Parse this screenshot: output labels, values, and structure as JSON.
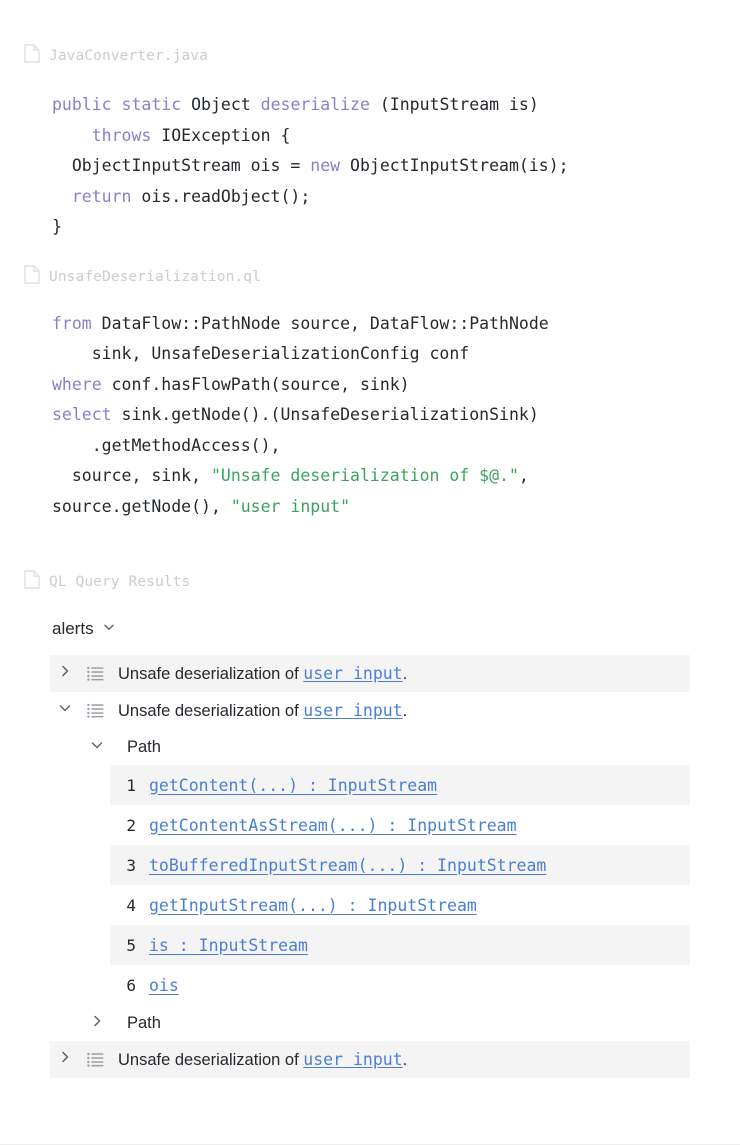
{
  "files": [
    {
      "icon": "document-icon",
      "name": "JavaConverter.java"
    },
    {
      "icon": "document-icon",
      "name": "UnsafeDeserialization.ql"
    },
    {
      "icon": "document-icon",
      "name": "QL Query Results"
    }
  ],
  "java_code": {
    "language": "java",
    "lines": [
      [
        {
          "t": "public",
          "c": "kw"
        },
        {
          "t": " ",
          "c": ""
        },
        {
          "t": "static",
          "c": "kw"
        },
        {
          "t": " Object ",
          "c": ""
        },
        {
          "t": "deserialize",
          "c": "kw"
        },
        {
          "t": " (InputStream is)",
          "c": ""
        }
      ],
      [
        {
          "t": "    ",
          "c": ""
        },
        {
          "t": "throws",
          "c": "kw"
        },
        {
          "t": " IOException {",
          "c": ""
        }
      ],
      [
        {
          "t": "  ObjectInputStream ois = ",
          "c": ""
        },
        {
          "t": "new",
          "c": "kw"
        },
        {
          "t": " ObjectInputStream(is);",
          "c": ""
        }
      ],
      [
        {
          "t": "  ",
          "c": ""
        },
        {
          "t": "return",
          "c": "kw"
        },
        {
          "t": " ois.readObject();",
          "c": ""
        }
      ],
      [
        {
          "t": "}",
          "c": ""
        }
      ]
    ]
  },
  "ql_code": {
    "language": "ql",
    "lines": [
      [
        {
          "t": "from",
          "c": "kw"
        },
        {
          "t": " DataFlow::PathNode source, DataFlow::PathNode",
          "c": ""
        }
      ],
      [
        {
          "t": "    sink, UnsafeDeserializationConfig conf",
          "c": ""
        }
      ],
      [
        {
          "t": "where",
          "c": "kw"
        },
        {
          "t": " conf.hasFlowPath(source, sink)",
          "c": ""
        }
      ],
      [
        {
          "t": "select",
          "c": "kw"
        },
        {
          "t": " sink.getNode().(UnsafeDeserializationSink)",
          "c": ""
        }
      ],
      [
        {
          "t": "    .getMethodAccess(),",
          "c": ""
        }
      ],
      [
        {
          "t": "  source, sink, ",
          "c": ""
        },
        {
          "t": "\"Unsafe deserialization of $@.\"",
          "c": "str"
        },
        {
          "t": ",",
          "c": ""
        }
      ],
      [
        {
          "t": "source.getNode(), ",
          "c": ""
        },
        {
          "t": "\"user input\"",
          "c": "str"
        }
      ]
    ]
  },
  "results": {
    "selector_label": "alerts",
    "selector_icon": "chevron-down-icon",
    "alerts": [
      {
        "expanded": false,
        "twisty_icon": "chevron-right-icon",
        "row_icon": "list-icon",
        "shaded": true,
        "text_before": "Unsafe deserialization of ",
        "link": "user input",
        "text_after": "."
      },
      {
        "expanded": true,
        "twisty_icon": "chevron-down-icon",
        "row_icon": "list-icon",
        "shaded": false,
        "text_before": "Unsafe deserialization of ",
        "link": "user input",
        "text_after": "."
      },
      {
        "expanded": false,
        "twisty_icon": "chevron-right-icon",
        "row_icon": "list-icon",
        "shaded": true,
        "text_before": "Unsafe deserialization of ",
        "link": "user input",
        "text_after": "."
      }
    ],
    "path_open": {
      "label": "Path",
      "twisty_icon": "chevron-down-icon",
      "steps": [
        {
          "index": "1",
          "label": "getContent(...) : InputStream",
          "shaded": true
        },
        {
          "index": "2",
          "label": "getContentAsStream(...) : InputStream",
          "shaded": false
        },
        {
          "index": "3",
          "label": "toBufferedInputStream(...) : InputStream",
          "shaded": true
        },
        {
          "index": "4",
          "label": "getInputStream(...) : InputStream",
          "shaded": false
        },
        {
          "index": "5",
          "label": "is : InputStream",
          "shaded": true
        },
        {
          "index": "6",
          "label": "ois",
          "shaded": false
        }
      ]
    },
    "path_closed": {
      "label": "Path",
      "twisty_icon": "chevron-right-icon"
    }
  },
  "colors": {
    "keyword": "#8a7fc9",
    "string": "#3ca35d",
    "link": "#4a7fd4",
    "text": "#24292e",
    "file_label": "#c9ccd1",
    "row_shade": "#f4f4f5"
  }
}
